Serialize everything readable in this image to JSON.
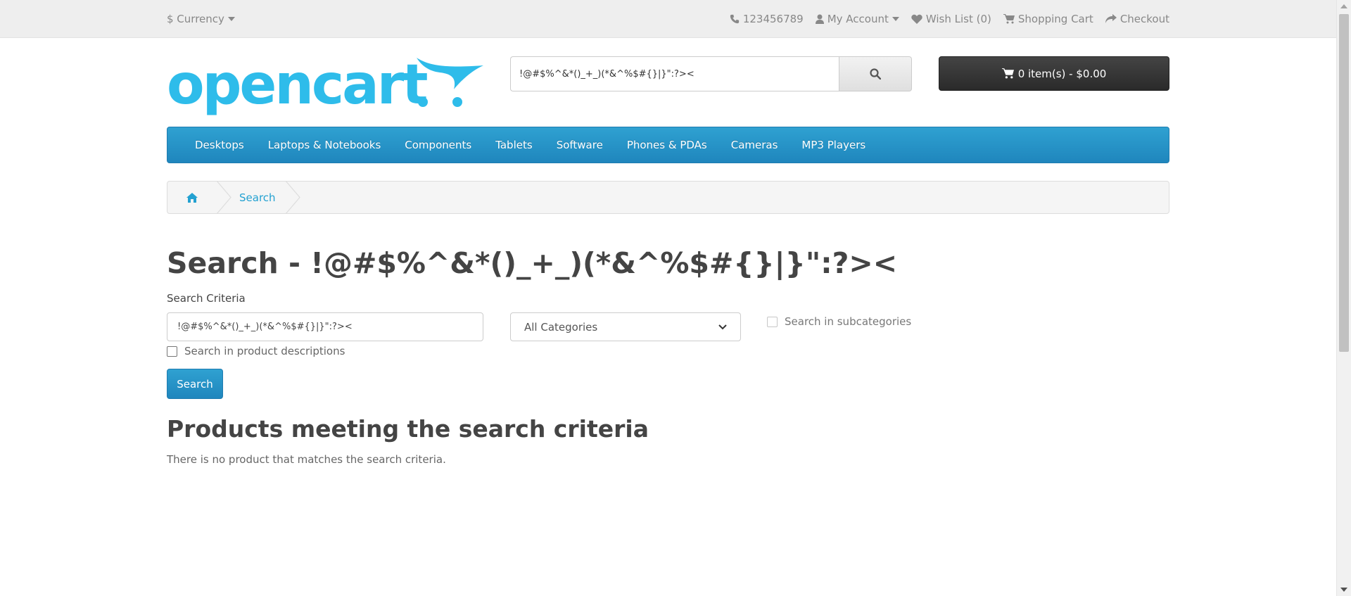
{
  "top_bar": {
    "currency_label": "$ Currency",
    "phone": "123456789",
    "account_label": "My Account",
    "wishlist_label": "Wish List (0)",
    "cart_label": "Shopping Cart",
    "checkout_label": "Checkout"
  },
  "header": {
    "logo_text": "opencart",
    "search_value": "!@#$%^&*()_+_)(*&^%$#{}|}\":?><",
    "cart_button": "0 item(s) - $0.00"
  },
  "menu": {
    "items": [
      "Desktops",
      "Laptops & Notebooks",
      "Components",
      "Tablets",
      "Software",
      "Phones & PDAs",
      "Cameras",
      "MP3 Players"
    ]
  },
  "breadcrumb": {
    "current": "Search"
  },
  "content": {
    "title": "Search - !@#$%^&*()_+_)(*&^%$#{}|}\":?><",
    "criteria_label": "Search Criteria",
    "criteria_value": "!@#$%^&*()_+_)(*&^%$#{}|}\":?><",
    "category_selected": "All Categories",
    "subcategories_label": "Search in subcategories",
    "descriptions_label": "Search in product descriptions",
    "search_button": "Search",
    "results_heading": "Products meeting the search criteria",
    "no_results": "There is no product that matches the search criteria."
  },
  "colors": {
    "brand_blue": "#229ac8",
    "logo_blue": "#2ebcea",
    "cart_dark": "#363636"
  },
  "icons": [
    "phone-icon",
    "user-icon",
    "heart-icon",
    "cart-icon",
    "share-icon",
    "search-icon",
    "home-icon"
  ]
}
